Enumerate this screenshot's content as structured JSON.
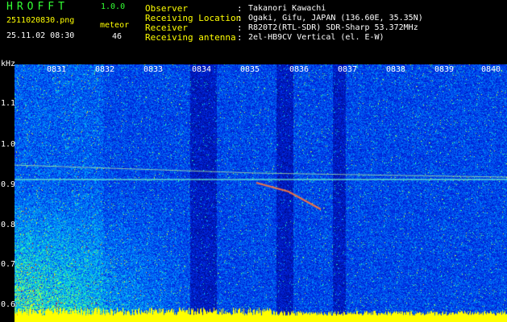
{
  "header": {
    "app_title": "HROFFT",
    "app_version": "1.0.0",
    "file_name": "2511020830.png",
    "timestamp": "25.11.02 08:30",
    "meteor_label": "meteor",
    "meteor_count": "46"
  },
  "info": [
    {
      "key": "Observer",
      "colon": ":",
      "value": "Takanori Kawachi"
    },
    {
      "key": "Receiving Location",
      "colon": ":",
      "value": "Ogaki, Gifu, JAPAN (136.60E, 35.35N)"
    },
    {
      "key": "Receiver",
      "colon": ":",
      "value": "R820T2(RTL-SDR) SDR-Sharp 53.372MHz"
    },
    {
      "key": "Receiving antenna",
      "colon": ":",
      "value": "2el-HB9CV Vertical (el. E-W)"
    }
  ],
  "axes": {
    "unit": "kHz",
    "time_ticks": [
      "0831",
      "0832",
      "0833",
      "0834",
      "0835",
      "0836",
      "0837",
      "0838",
      "0839",
      "0840"
    ],
    "freq_ticks": [
      "1.1",
      "1.0",
      "0.9",
      "0.8",
      "0.7",
      "0.6"
    ]
  },
  "colors": {
    "background": "#000000",
    "header_green": "#33ff33",
    "header_white": "#ffffff",
    "header_yellow": "#ffff00",
    "spectrogram_low": "#00007f",
    "spectrogram_high": "#ff0000",
    "baseline": "#ffff00"
  }
}
